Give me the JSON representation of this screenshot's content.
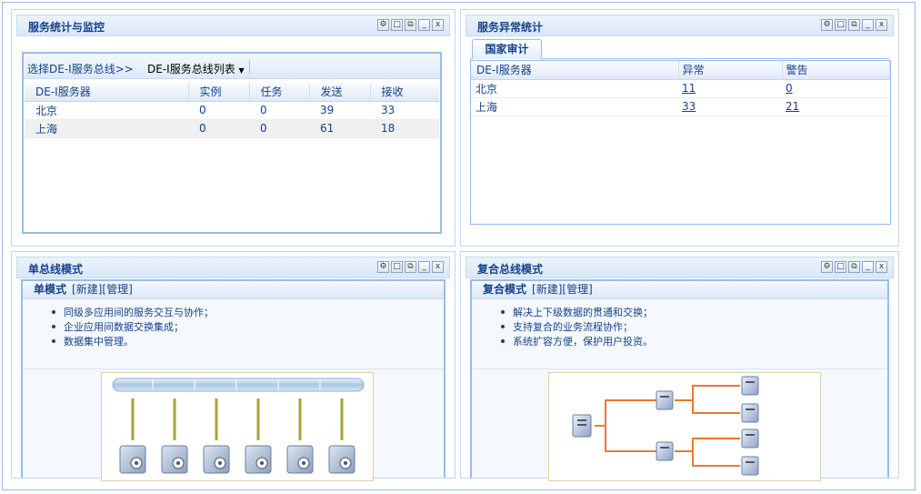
{
  "tools": [
    "⚙",
    "□",
    "⧉",
    "_",
    "x"
  ],
  "p1": {
    "title": "服务统计与监控",
    "toolbar_prefix": "选择DE-I服务总线>>",
    "dropdown": "DE-I服务总线列表",
    "columns": [
      "DE-I服务器",
      "实例",
      "任务",
      "发送",
      "接收"
    ],
    "rows": [
      [
        "北京",
        "0",
        "0",
        "39",
        "33"
      ],
      [
        "上海",
        "0",
        "0",
        "61",
        "18"
      ]
    ]
  },
  "p2": {
    "title": "服务异常统计",
    "tab": "国家审计",
    "columns": [
      "DE-I服务器",
      "异常",
      "警告"
    ],
    "rows": [
      [
        "北京",
        "11",
        "0"
      ],
      [
        "上海",
        "33",
        "21"
      ]
    ]
  },
  "p3": {
    "title": "单总线模式",
    "mode_title": "单模式",
    "link_new": "[新建]",
    "link_manage": "[管理]",
    "bullets": [
      "同级多应用间的服务交互与协作；",
      "企业应用间数据交换集成；",
      "数据集中管理。"
    ]
  },
  "p4": {
    "title": "复合总线模式",
    "mode_title": "复合模式",
    "link_new": "[新建]",
    "link_manage": "[管理]",
    "bullets": [
      "解决上下级数据的贯通和交换；",
      "支持复合的业务流程协作；",
      "系统扩容方便，保护用户投资。"
    ]
  },
  "colors": {
    "accent": "#15428b",
    "border": "#99bbe8",
    "bus": "#b7cfe6",
    "line_orange": "#e87a2c",
    "line_olive": "#a5a53a"
  }
}
